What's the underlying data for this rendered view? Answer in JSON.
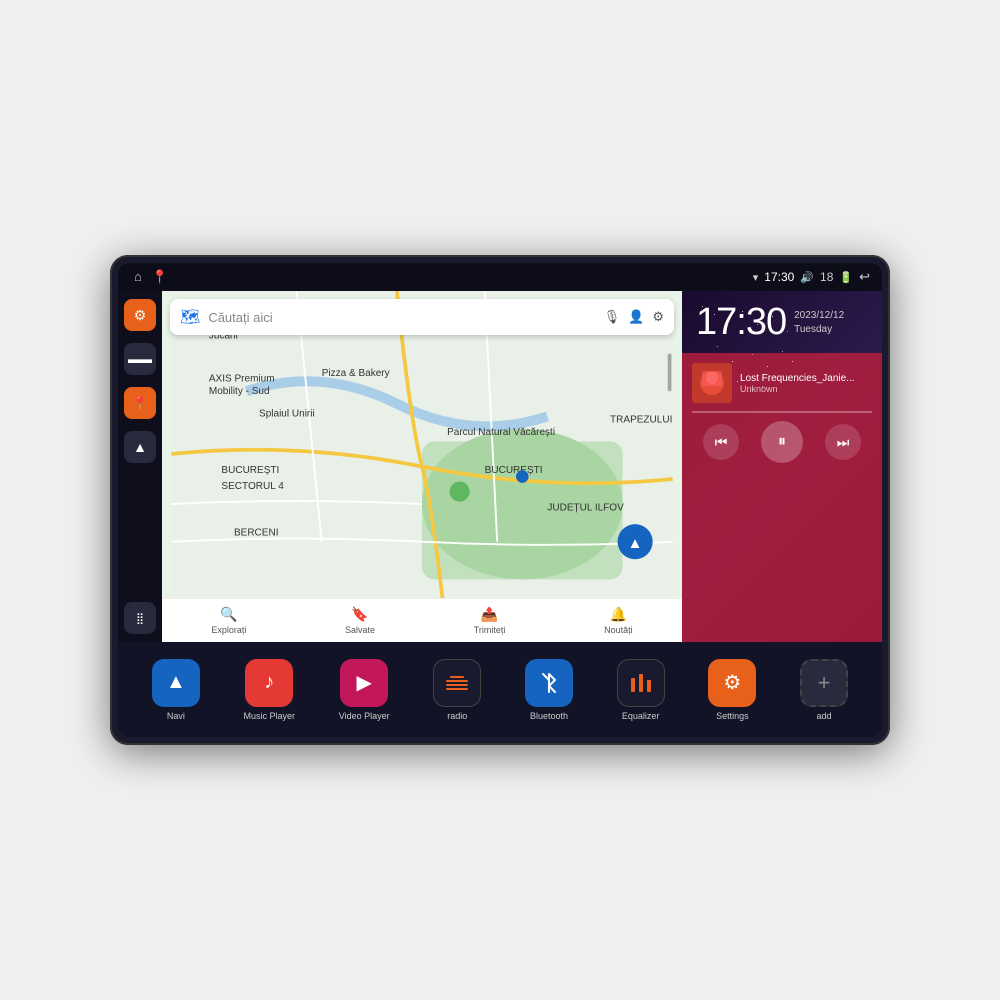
{
  "device": {
    "status_bar": {
      "left_icons": [
        "home",
        "location"
      ],
      "time": "17:30",
      "wifi_icon": "wifi",
      "volume_icon": "volume",
      "battery_num": "18",
      "battery_icon": "battery",
      "back_icon": "back"
    },
    "date": {
      "full": "2023/12/12",
      "day": "Tuesday"
    },
    "sidebar": {
      "items": [
        {
          "label": "settings",
          "icon": "⚙",
          "color": "orange"
        },
        {
          "label": "files",
          "icon": "▬",
          "color": "dark"
        },
        {
          "label": "map",
          "icon": "📍",
          "color": "orange"
        },
        {
          "label": "nav",
          "icon": "▲",
          "color": "dark"
        },
        {
          "label": "apps",
          "icon": "⋮⋮⋮",
          "color": "dark",
          "bottom": true
        }
      ]
    },
    "map": {
      "search_placeholder": "Căutați aici",
      "bottom_items": [
        {
          "icon": "🔍",
          "label": "Explorați"
        },
        {
          "icon": "🔖",
          "label": "Salvate"
        },
        {
          "icon": "📤",
          "label": "Trimiteți"
        },
        {
          "icon": "🔔",
          "label": "Noutăți"
        }
      ]
    },
    "music": {
      "title": "Lost Frequencies_Janie...",
      "artist": "Unknown",
      "prev_label": "⏮",
      "play_label": "⏸",
      "next_label": "⏭"
    },
    "apps": [
      {
        "id": "navi",
        "label": "Navi",
        "icon": "▲",
        "color": "blue-dark"
      },
      {
        "id": "music-player",
        "label": "Music Player",
        "icon": "♪",
        "color": "red"
      },
      {
        "id": "video-player",
        "label": "Video Player",
        "icon": "▶",
        "color": "pink"
      },
      {
        "id": "radio",
        "label": "radio",
        "icon": "〰",
        "color": "dark-wave"
      },
      {
        "id": "bluetooth",
        "label": "Bluetooth",
        "icon": "☆",
        "color": "blue"
      },
      {
        "id": "equalizer",
        "label": "Equalizer",
        "icon": "▮▮▮",
        "color": "dark-eq"
      },
      {
        "id": "settings",
        "label": "Settings",
        "icon": "⚙",
        "color": "orange"
      },
      {
        "id": "add",
        "label": "add",
        "icon": "+",
        "color": "gray"
      }
    ]
  }
}
